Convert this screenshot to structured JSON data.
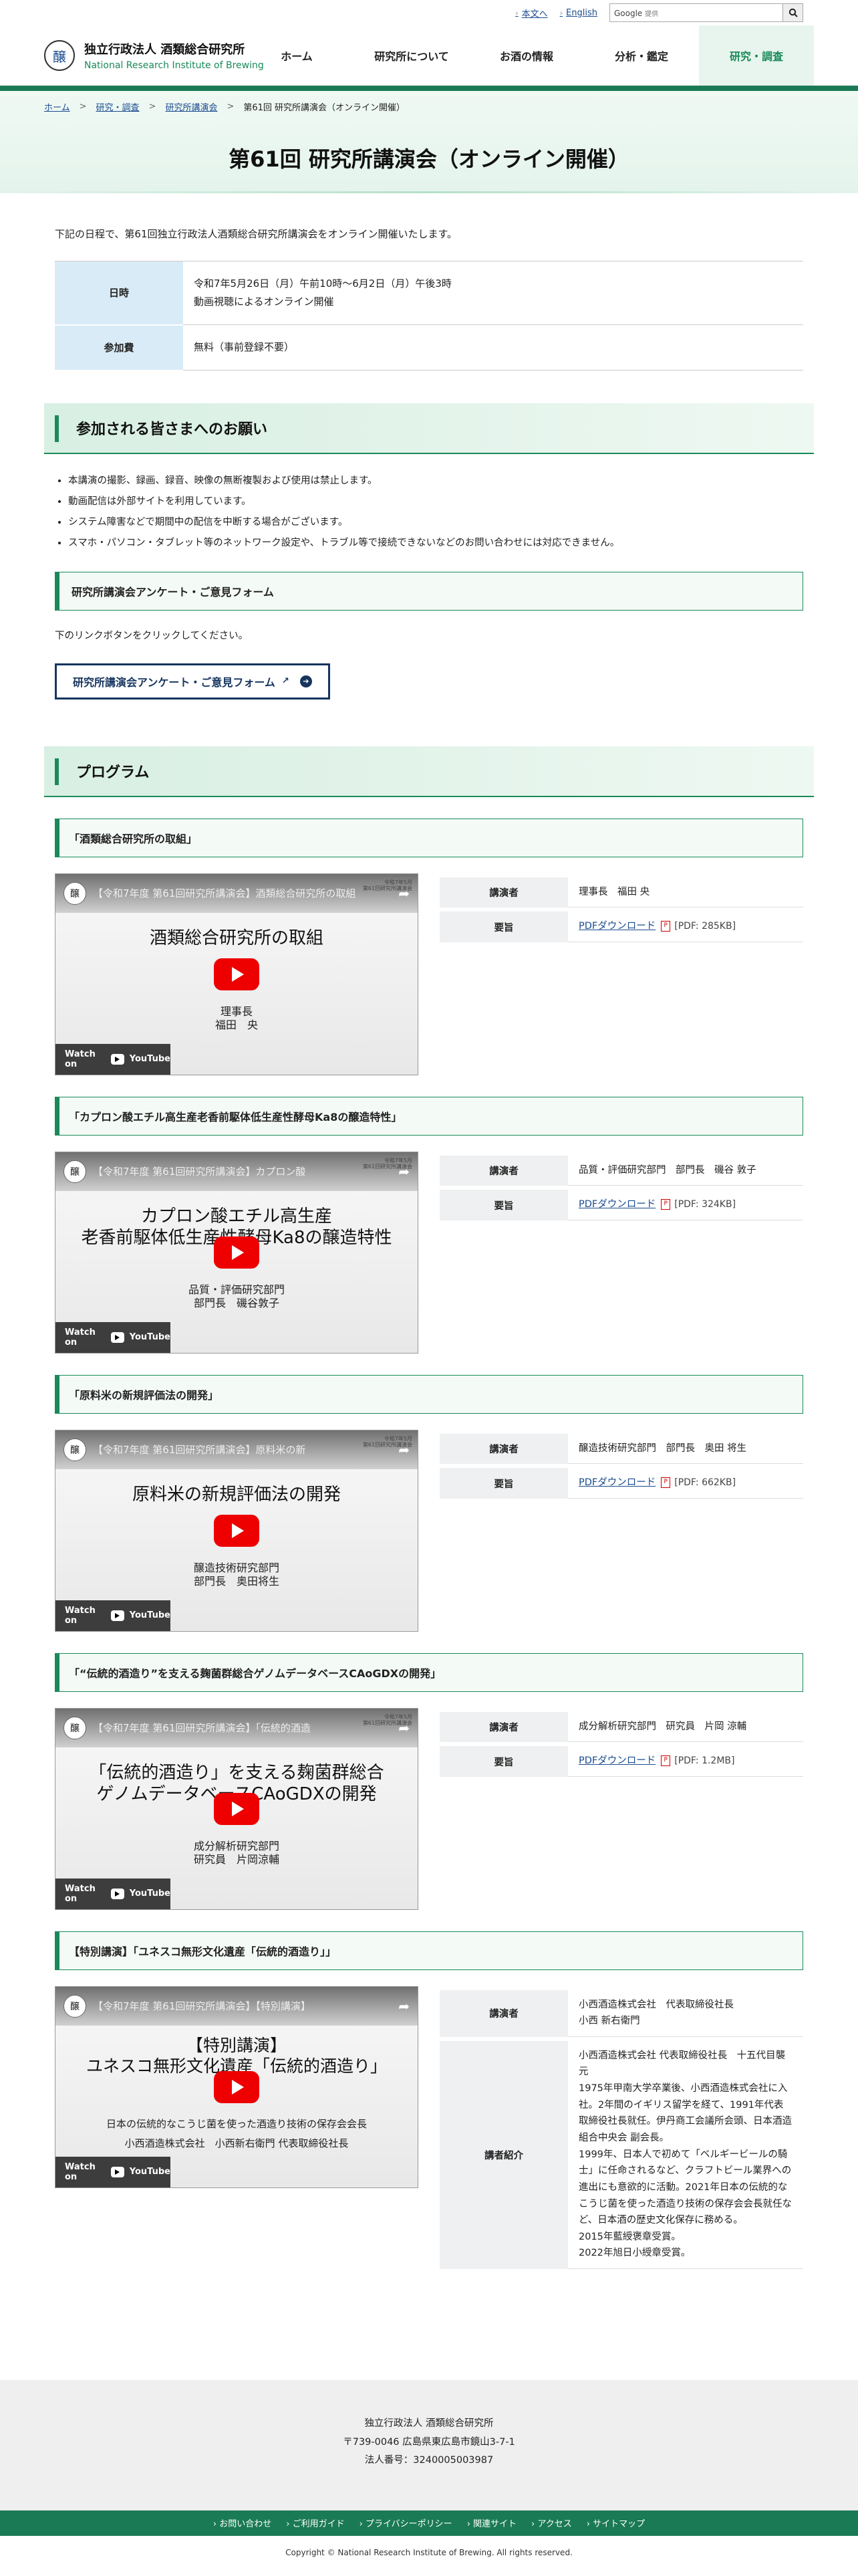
{
  "util": {
    "main_text": "本文へ",
    "english": "English",
    "search_brand": "Google",
    "search_sub": "提供"
  },
  "site": {
    "logo_glyph": "醸",
    "name_jp": "独立行政法人 酒類総合研究所",
    "name_en": "National Research Institute of Brewing"
  },
  "nav": [
    {
      "label": "ホーム"
    },
    {
      "label": "研究所について"
    },
    {
      "label": "お酒の情報"
    },
    {
      "label": "分析・鑑定"
    },
    {
      "label": "研究・調査"
    }
  ],
  "breadcrumb": [
    "ホーム",
    "研究・調査",
    "研究所講演会",
    "第61回 研究所講演会（オンライン開催）"
  ],
  "page_title": "第61回 研究所講演会（オンライン開催）",
  "intro": "下記の日程で、第61回独立行政法人酒類総合研究所講演会をオンライン開催いたします。",
  "info": {
    "date_label": "日時",
    "date_line1": "令和7年5月26日（月）午前10時～6月2日（月）午後3時",
    "date_line2": "動画視聴によるオンライン開催",
    "fee_label": "参加費",
    "fee_value": "無料（事前登録不要）"
  },
  "request": {
    "heading": "参加される皆さまへのお願い",
    "notes": [
      "本講演の撮影、録画、録音、映像の無断複製および使用は禁止します。",
      "動画配信は外部サイトを利用しています。",
      "システム障害などで期間中の配信を中断する場合がございます。",
      "スマホ・パソコン・タブレット等のネットワーク設定や、トラブル等で接続できないなどのお問い合わせには対応できません。"
    ]
  },
  "survey": {
    "heading": "研究所講演会アンケート・ご意見フォーム",
    "text": "下のリンクボタンをクリックしてください。",
    "button": "研究所講演会アンケート・ご意見フォーム",
    "ext_icon": "↗",
    "arrow_icon": "➔"
  },
  "program": {
    "heading": "プログラム",
    "lecturer_label": "講演者",
    "abstract_label": "要旨",
    "pdf_text": "PDFダウンロード",
    "pdf_glyph": "P",
    "watch_on": "Watch on",
    "yt_label": "YouTube",
    "video_date": "令和7年5月\n第61回研究所講演会",
    "lectures": [
      {
        "title": "「酒類総合研究所の取組」",
        "video_title": "【令和7年度 第61回研究所講演会】酒類総合研究所の取組",
        "video_main": "酒類総合研究所の取組",
        "video_sub1": "理事長",
        "video_sub2": "福田　央",
        "lecturer": "理事長　福田 央",
        "pdf_size": "[PDF: 285KB]"
      },
      {
        "title": "「カプロン酸エチル高生産老香前駆体低生産性酵母Ka8の醸造特性」",
        "video_title": "【令和7年度 第61回研究所講演会】カプロン酸",
        "video_main": "カプロン酸エチル高生産\n老香前駆体低生産性酵母Ka8の醸造特性",
        "video_sub1": "品質・評価研究部門",
        "video_sub2": "部門長　磯谷敦子",
        "lecturer": "品質・評価研究部門　部門長　磯谷 敦子",
        "pdf_size": "[PDF: 324KB]"
      },
      {
        "title": "「原料米の新規評価法の開発」",
        "video_title": "【令和7年度 第61回研究所講演会】原料米の新",
        "video_main": "原料米の新規評価法の開発",
        "video_sub1": "醸造技術研究部門",
        "video_sub2": "部門長　奥田将生",
        "lecturer": "醸造技術研究部門　部門長　奥田 将生",
        "pdf_size": "[PDF: 662KB]"
      },
      {
        "title": "「“伝統的酒造り”を支える麹菌群総合ゲノムデータベースCAoGDXの開発」",
        "video_title": "【令和7年度 第61回研究所講演会】「伝統的酒造",
        "video_main": "「伝統的酒造り」を支える麹菌群総合\nゲノムデータベースCAoGDXの開発",
        "video_sub1": "成分解析研究部門",
        "video_sub2": "研究員　片岡涼輔",
        "lecturer": "成分解析研究部門　研究員　片岡 涼輔",
        "pdf_size": "[PDF: 1.2MB]"
      }
    ],
    "special": {
      "title": "【特別講演】「ユネスコ無形文化遺産「伝統的酒造り」」",
      "video_title": "【令和7年度 第61回研究所講演会】【特別講演】",
      "video_main": "【特別講演】\nユネスコ無形文化遺産「伝統的酒造り」",
      "video_sub1": "日本の伝統的なこうじ菌を使った酒造り技術の保存会会長",
      "video_sub2": "小西酒造株式会社　小西新右衛門 代表取締役社長",
      "lecturer": "小西酒造株式会社　代表取締役社長\n小西 新右衛門",
      "profile_label": "講者紹介",
      "profile": "小西酒造株式会社 代表取締役社長　十五代目襲元\n1975年甲南大学卒業後、小西酒造株式会社に入社。2年間のイギリス留学を経て、1991年代表取締役社長就任。伊丹商工会議所会頭、日本酒造組合中央会 副会長。\n1999年、日本人で初めて「ベルギービールの騎士」に任命されるなど、クラフトビール業界への進出にも意欲的に活動。2021年日本の伝統的なこうじ菌を使った酒造り技術の保存会会長就任など、日本酒の歴史文化保存に務める。\n2015年藍綬褒章受賞。\n2022年旭日小綬章受賞。"
    }
  },
  "footer": {
    "org": "独立行政法人 酒類総合研究所",
    "address": "〒739-0046 広島県東広島市鏡山3-7-1",
    "corp_no": "法人番号：3240005003987",
    "links": [
      "お問い合わせ",
      "ご利用ガイド",
      "プライバシーポリシー",
      "関連サイト",
      "アクセス",
      "サイトマップ"
    ],
    "copyright": "Copyright © National Research Institute of Brewing. All rights reserved."
  }
}
